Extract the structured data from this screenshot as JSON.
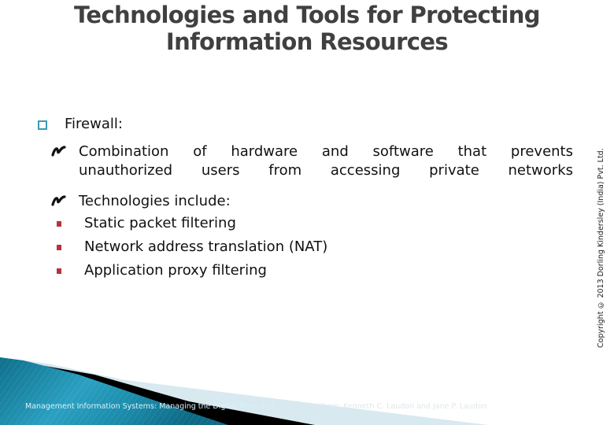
{
  "slide": {
    "title": "Technologies and Tools for Protecting Information Resources",
    "bullets": {
      "level1": {
        "icon": "hollow-square-bullet",
        "text": "Firewall:"
      },
      "level2": [
        {
          "icon": "curl-bullet",
          "line1": "Combination of hardware and software that prevents",
          "line2": "unauthorized users from accessing private networks"
        },
        {
          "icon": "curl-bullet",
          "text": "Technologies include:"
        }
      ],
      "level3": [
        {
          "icon": "red-square-bullet",
          "text": "Static packet filtering"
        },
        {
          "icon": "red-square-bullet",
          "text": "Network address translation (NAT)"
        },
        {
          "icon": "red-square-bullet",
          "text": "Application proxy filtering"
        }
      ]
    },
    "copyright": "Copyright © 2013 Dorling Kindersley (India) Pvt. Ltd.",
    "footer": {
      "book": "Management Information Systems: Managing the Digital Firm, 12e",
      "authors": "Authors: Kenneth C. Laudon and Jane P. Laudon"
    },
    "colors": {
      "title": "#404040",
      "box_bullet": "#3b9bb3",
      "square_bullet": "#b8323a",
      "footer_teal": "#1a89a8"
    }
  }
}
